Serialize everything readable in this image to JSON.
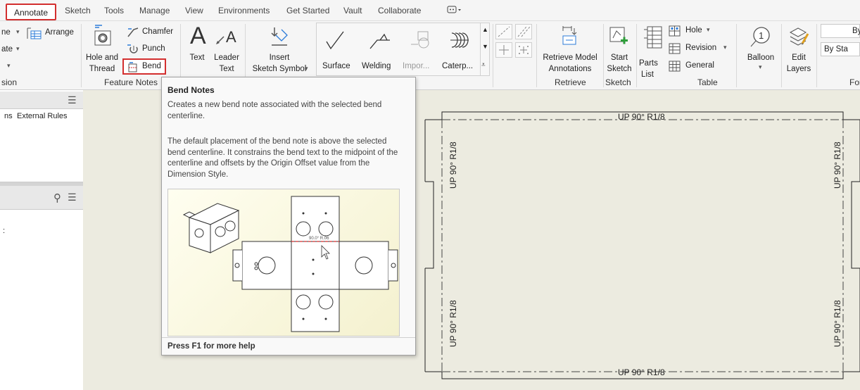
{
  "tabs": [
    "Annotate",
    "Sketch",
    "Tools",
    "Manage",
    "View",
    "Environments",
    "Get Started",
    "Vault",
    "Collaborate"
  ],
  "ribbon": {
    "partial_left": [
      "ne",
      "ate",
      "sion"
    ],
    "arrange": "Arrange",
    "hole_and_thread": [
      "Hole and",
      "Thread"
    ],
    "chamfer": "Chamfer",
    "punch": "Punch",
    "bend": "Bend",
    "feature_notes": "Feature Notes",
    "text": "Text",
    "leader_text": [
      "Leader",
      "Text"
    ],
    "insert_sketch_symbol": [
      "Insert",
      "Sketch Symbol"
    ],
    "surface": "Surface",
    "welding": "Welding",
    "import": "Impor...",
    "caterpillar": "Caterp...",
    "retrieve_model_annotations": [
      "Retrieve Model",
      "Annotations"
    ],
    "retrieve": "Retrieve",
    "start_sketch": [
      "Start",
      "Sketch"
    ],
    "sketch_group": "Sketch",
    "parts_list": [
      "Parts",
      "List"
    ],
    "hole_table": "Hole",
    "revision_table": "Revision",
    "general_table": "General",
    "table_group": "Table",
    "balloon": "Balloon",
    "edit_layers": [
      "Edit",
      "Layers"
    ],
    "by_partial": "By",
    "by_standard_partial": "By Sta",
    "format_partial": "For"
  },
  "left_panel": {
    "tab_partial": "ns",
    "external_rules": "External Rules",
    "colon": ":"
  },
  "tooltip": {
    "title": "Bend Notes",
    "para1": "Creates a new bend note associated with the selected bend centerline.",
    "para2": "The default placement of the bend note is above the selected bend centerline. It constrains the bend text to the midpoint of the centerline and offsets by the Origin Offset value from the Dimension Style.",
    "image_note": "90.0° R.06",
    "footer": "Press F1 for more help"
  },
  "drawing": {
    "note_top": "UP 90° R1/8",
    "note_bottom": "UP 90° R1/8",
    "note_left_top": "UP 90° R1/8",
    "note_left_bottom": "UP 90° R1/8",
    "note_right_top": "UP 90° R1/8",
    "note_right_bottom": "UP 90° R1/8"
  },
  "colors": {
    "highlight_red": "#d32f2f",
    "canvas": "#ecebe0",
    "accent_blue": "#2b7bd8",
    "accent_green": "#2e9d3a"
  }
}
